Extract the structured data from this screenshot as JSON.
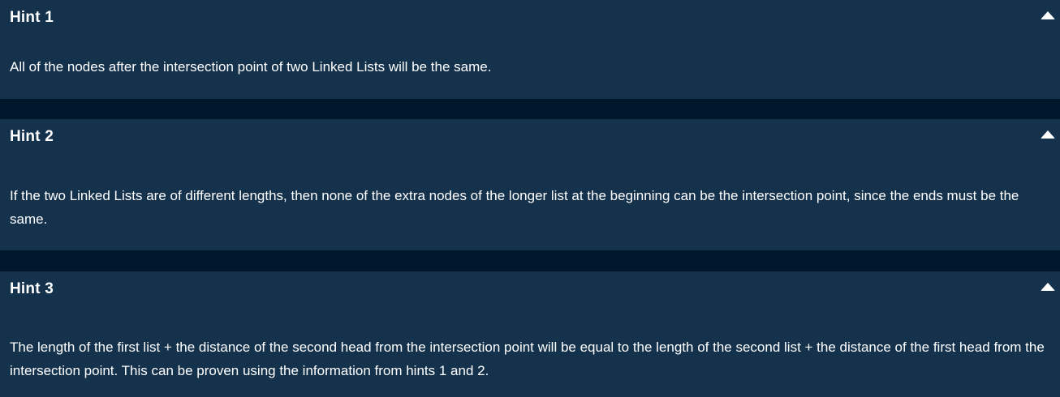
{
  "hints": [
    {
      "title": "Hint 1",
      "body": "All of the nodes after the intersection point of two Linked Lists will be the same.",
      "collapse_icon": "chevron-up-icon"
    },
    {
      "title": "Hint 2",
      "body": "If the two Linked Lists are of different lengths, then none of the extra nodes of the longer list at the beginning can be the intersection point, since the ends must be the same.",
      "collapse_icon": "chevron-up-icon"
    },
    {
      "title": "Hint 3",
      "body": "The length of the first list + the distance of the second head from the intersection point will be equal to the length of the second list + the distance of the first head from the intersection point. This can be proven using the information from hints 1 and 2.",
      "collapse_icon": "chevron-up-icon"
    }
  ],
  "colors": {
    "panel_background": "#15324d",
    "page_background": "#00162b",
    "text": "#ffffff"
  }
}
